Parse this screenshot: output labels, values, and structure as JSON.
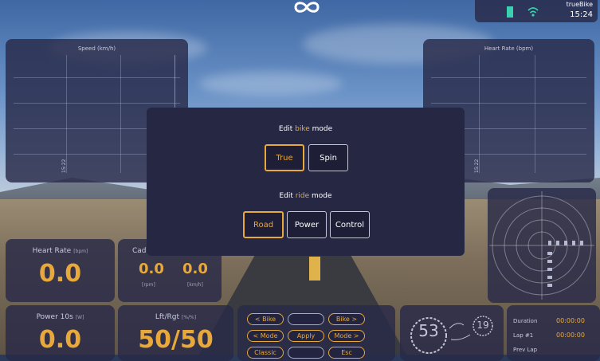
{
  "status": {
    "app_name": "trueBike",
    "time": "15:24"
  },
  "charts": {
    "speed": {
      "title": "Speed (km/h)",
      "time_label": "15:22"
    },
    "heart_rate": {
      "title": "Heart Rate (bpm)",
      "time_label": "15:22"
    }
  },
  "metrics": {
    "heart_rate": {
      "title": "Heart Rate",
      "unit": "[bpm]",
      "value": "0.0"
    },
    "cadence": {
      "title": "Cad",
      "value_rpm": "0.0",
      "unit_rpm": "[rpm]",
      "value_kmh": "0.0",
      "unit_kmh": "[km/h]"
    },
    "power": {
      "title": "Power 10s",
      "unit": "[W]",
      "value": "0.0"
    },
    "balance": {
      "title": "Lft/Rgt",
      "unit": "[%/%]",
      "value": "50/50"
    }
  },
  "dialog": {
    "bike_prefix": "Edit ",
    "bike_word": "bike",
    "bike_suffix": " mode",
    "bike_options": [
      "True",
      "Spin"
    ],
    "bike_selected": "True",
    "ride_prefix": "Edit ",
    "ride_word": "ride",
    "ride_suffix": " mode",
    "ride_options": [
      "Road",
      "Power",
      "Control"
    ],
    "ride_selected": "Road"
  },
  "controls": {
    "bike_prev": "< Bike",
    "bike_next": "Bike >",
    "mode_prev": "< Mode",
    "apply": "Apply",
    "mode_next": "Mode >",
    "classic": "Classic",
    "esc": "Esc"
  },
  "gear": {
    "front": "53",
    "rear": "19"
  },
  "stats": {
    "duration_label": "Duration",
    "duration_value": "00:00:00",
    "lap_label": "Lap #1",
    "lap_value": "00:00:00",
    "prev_lap_label": "Prev Lap"
  },
  "colors": {
    "accent": "#e8a93a",
    "panel": "#282a48",
    "dialog": "#262742"
  }
}
